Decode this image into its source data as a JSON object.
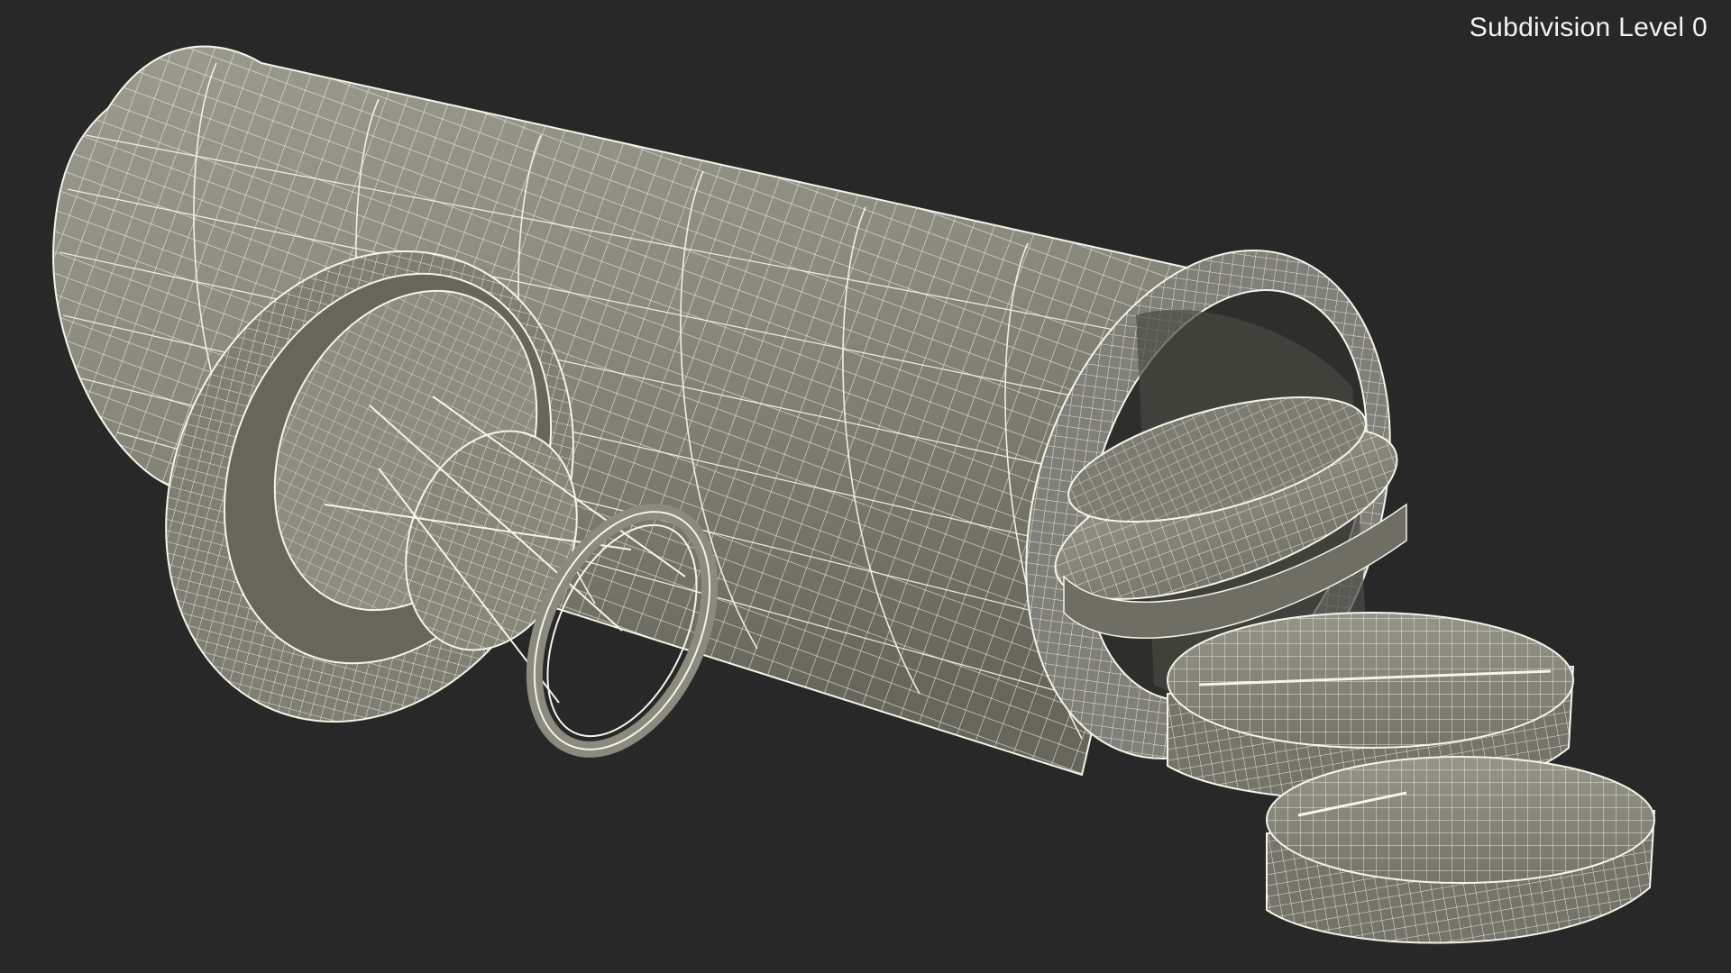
{
  "viewport": {
    "overlay_label": "Subdivision Level 0",
    "background_color": "#282828",
    "mesh_fill_color": "#8a8a7e",
    "mesh_shadow_color": "#6a6a60",
    "wire_color": "#f4f4e8"
  },
  "scene": {
    "objects": [
      "tube-body",
      "tube-open-end",
      "cap",
      "cap-inner-insert",
      "tablet-inside-1",
      "tablet-inside-2",
      "tablet-front",
      "tablet-bottom"
    ]
  }
}
